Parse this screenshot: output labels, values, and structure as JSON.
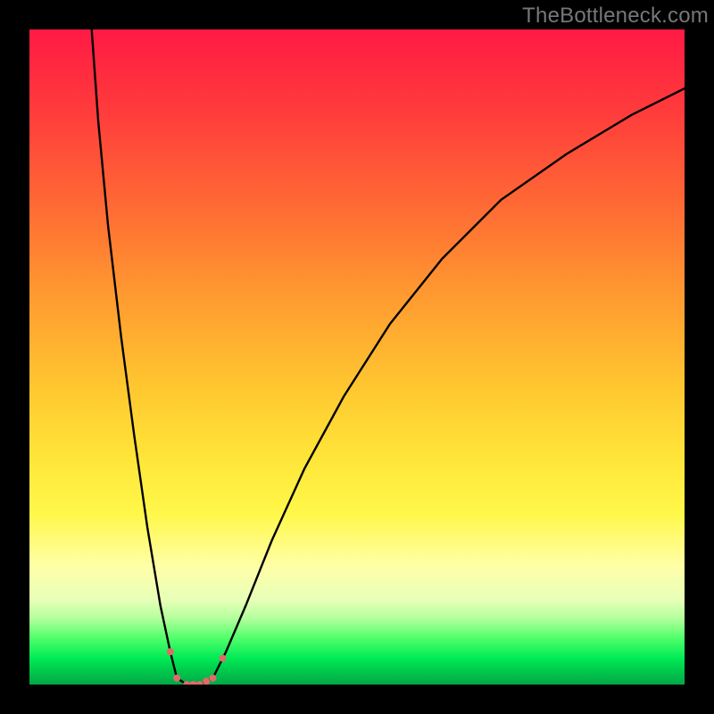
{
  "watermark": "TheBottleneck.com",
  "chart_data": {
    "type": "line",
    "title": "",
    "xlabel": "",
    "ylabel": "",
    "xlim": [
      0,
      100
    ],
    "ylim": [
      0,
      100
    ],
    "series": [
      {
        "name": "curve",
        "x": [
          9.5,
          10.5,
          12,
          14,
          16,
          18,
          20,
          21.5,
          22.5,
          24,
          26,
          28,
          30,
          33,
          37,
          42,
          48,
          55,
          63,
          72,
          82,
          92,
          100
        ],
        "y": [
          100,
          86,
          70,
          53,
          38,
          24,
          12,
          5,
          1,
          0,
          0,
          1,
          5,
          12,
          22,
          33,
          44,
          55,
          65,
          74,
          81,
          87,
          91
        ]
      }
    ],
    "markers": {
      "name": "points",
      "x": [
        21.5,
        22.5,
        24,
        25,
        26,
        27,
        28,
        29.5
      ],
      "y": [
        5,
        1,
        0,
        0,
        0,
        0.5,
        1,
        4
      ],
      "color": "#e06a6a",
      "size": 8
    },
    "gradient_stops": [
      {
        "pos": 0,
        "color": "#ff1a44"
      },
      {
        "pos": 27,
        "color": "#ff6a34"
      },
      {
        "pos": 55,
        "color": "#ffc830"
      },
      {
        "pos": 74,
        "color": "#fff84a"
      },
      {
        "pos": 90,
        "color": "#b0ff9a"
      },
      {
        "pos": 100,
        "color": "#00a846"
      }
    ]
  }
}
